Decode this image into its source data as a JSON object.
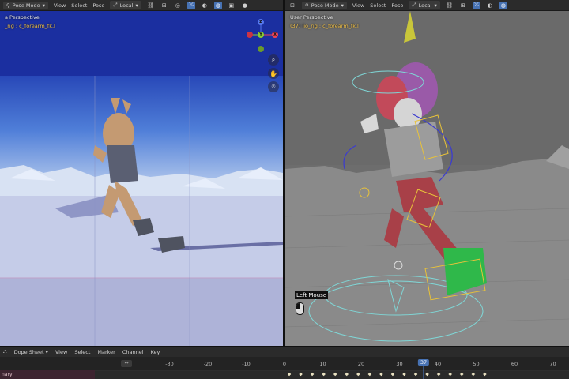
{
  "left_header": {
    "mode": "Pose Mode",
    "menus": [
      "View",
      "Select",
      "Pose"
    ],
    "orientation": "Local"
  },
  "right_header": {
    "mode": "Pose Mode",
    "menus": [
      "View",
      "Select",
      "Pose"
    ],
    "orientation": "Local"
  },
  "left_viewport": {
    "title": "a Perspective",
    "subtitle": "_rig : c_forearm_fk.l"
  },
  "right_viewport": {
    "title": "User Perspective",
    "subtitle": "(37) lio_rig : c_forearm_fk.l"
  },
  "gizmo": {
    "x": "X",
    "y": "Y",
    "z": "Z"
  },
  "screencast": {
    "key": "Left Mouse"
  },
  "dope_sheet": {
    "mode": "Dope Sheet",
    "menus": [
      "View",
      "Select",
      "Marker",
      "Channel",
      "Key"
    ],
    "summary_label": "nary",
    "current_frame": "37",
    "ruler_labels": [
      "-30",
      "-20",
      "-10",
      "0",
      "10",
      "20",
      "30",
      "40",
      "50",
      "60",
      "70"
    ],
    "keyframes": [
      0,
      3,
      6,
      9,
      12,
      15,
      18,
      21,
      24,
      27,
      30,
      33,
      36,
      39,
      42,
      45,
      48,
      51
    ]
  }
}
